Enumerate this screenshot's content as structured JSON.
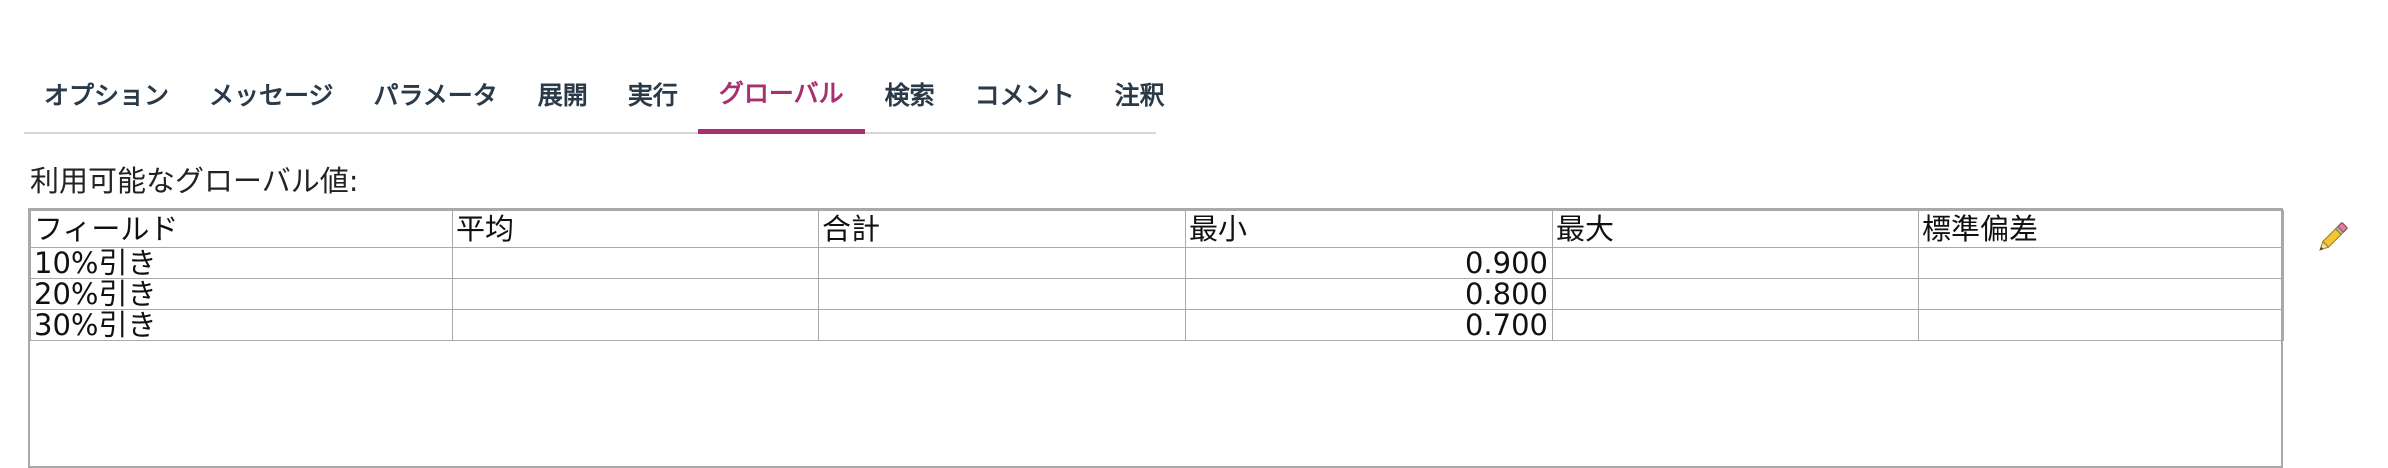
{
  "tabs": [
    {
      "label": "オプション"
    },
    {
      "label": "メッセージ"
    },
    {
      "label": "パラメータ"
    },
    {
      "label": "展開"
    },
    {
      "label": "実行"
    },
    {
      "label": "グローバル"
    },
    {
      "label": "検索"
    },
    {
      "label": "コメント"
    },
    {
      "label": "注釈"
    }
  ],
  "active_tab": "グローバル",
  "section_label": "利用可能なグローバル値:",
  "table": {
    "columns": [
      "フィールド",
      "平均",
      "合計",
      "最小",
      "最大",
      "標準偏差"
    ],
    "rows": [
      [
        "10%引き",
        "",
        "",
        "0.900",
        "",
        ""
      ],
      [
        "20%引き",
        "",
        "",
        "0.800",
        "",
        ""
      ],
      [
        "30%引き",
        "",
        "",
        "0.700",
        "",
        ""
      ]
    ]
  },
  "edit_icon": "pencil-icon",
  "colors": {
    "accent": "#a8306f",
    "tab_text": "#2b3a48",
    "grid_border": "#a9a9a9"
  }
}
